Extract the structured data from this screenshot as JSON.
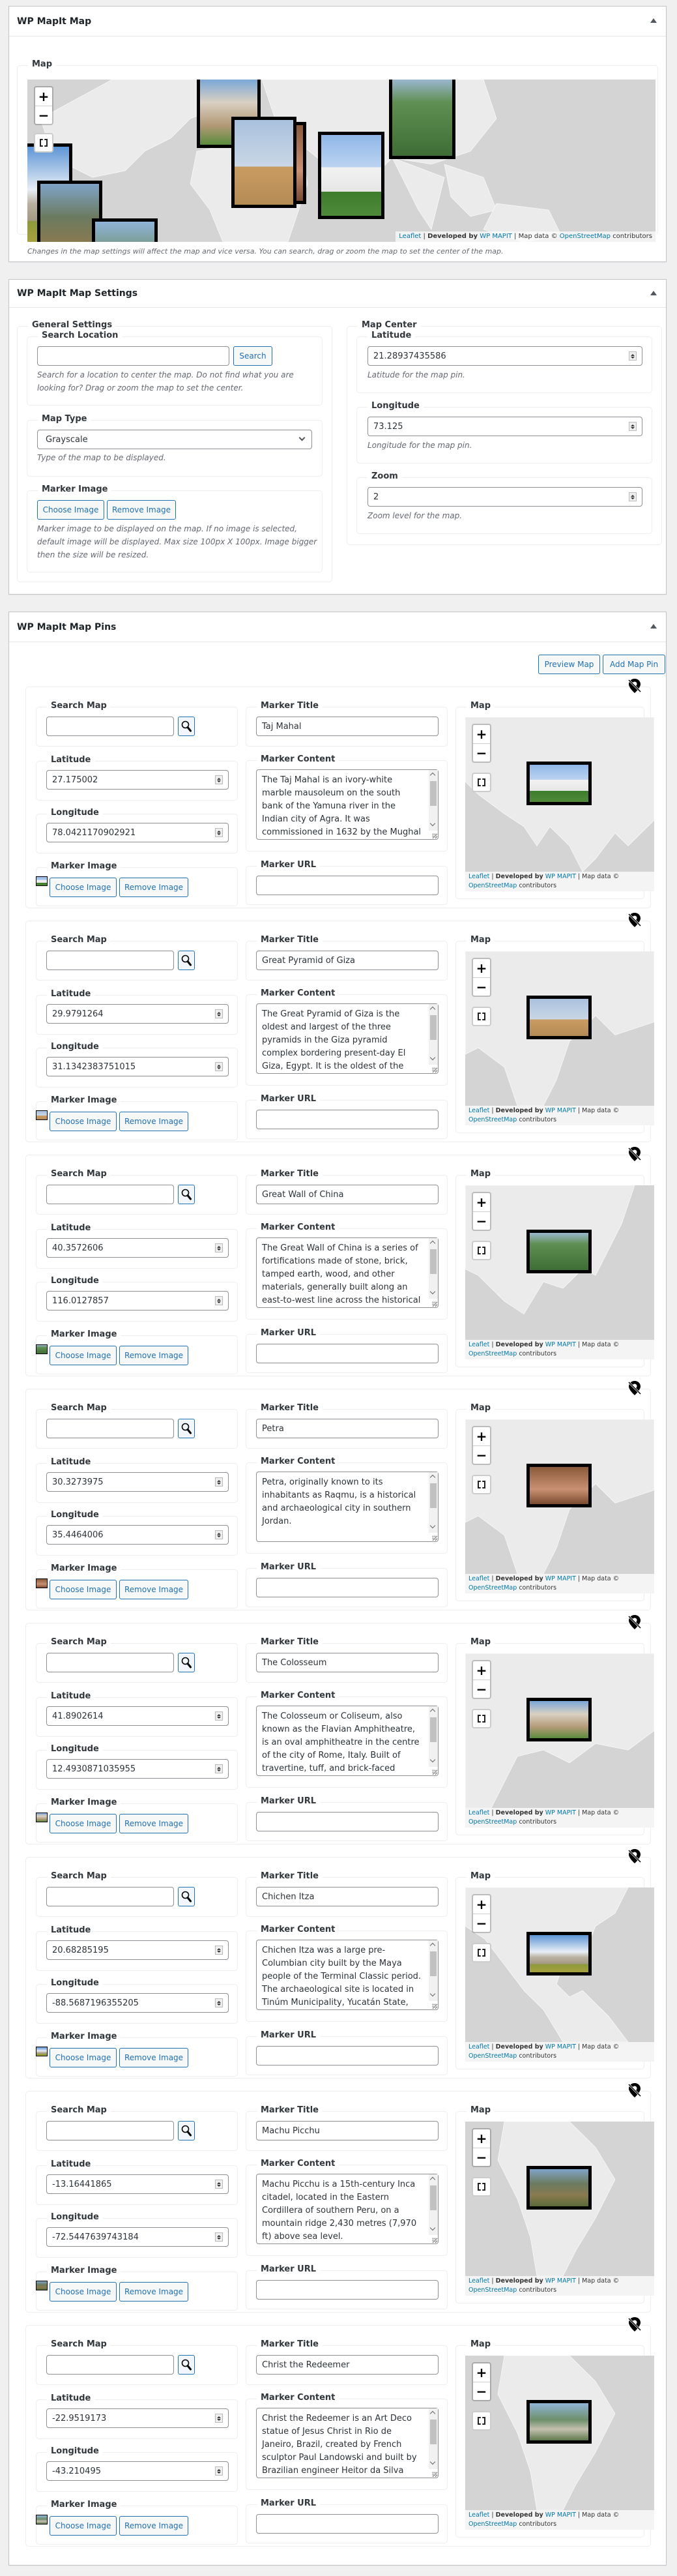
{
  "map_box": {
    "title": "WP MapIt Map",
    "map_label": "Map",
    "zoom_in": "+",
    "zoom_out": "−",
    "attribution": {
      "leaflet": "Leaflet",
      "developed_by": "Developed by",
      "wpmapit": "WP MAPIT",
      "map_data": "Map data ©",
      "osm": "OpenStreetMap",
      "contributors": "contributors"
    },
    "description": "Changes in the map settings will affect the map and vice versa. You can search, drag or zoom the map to set the center of the map.",
    "markers": [
      "The Colosseum",
      "Great Pyramid of Giza",
      "Petra",
      "Taj Mahal",
      "Great Wall of China",
      "Chichen Itza",
      "Machu Picchu",
      "Christ the Redeemer"
    ]
  },
  "settings_box": {
    "title": "WP MapIt Map Settings",
    "general": {
      "legend": "General Settings",
      "search_location": {
        "label": "Search Location",
        "value": "",
        "button": "Search",
        "description": "Search for a location to center the map. Do not find what you are looking for? Drag or zoom the map to set the center."
      },
      "map_type": {
        "label": "Map Type",
        "selected": "Grayscale",
        "description": "Type of the map to be displayed."
      },
      "marker_image": {
        "label": "Marker Image",
        "choose": "Choose Image",
        "remove": "Remove Image",
        "description": "Marker image to be displayed on the map. If no image is selected, default image will be displayed. Max size 100px X 100px. Image bigger then the size will be resized."
      }
    },
    "center": {
      "legend": "Map Center",
      "latitude": {
        "label": "Latitude",
        "value": "21.28937435586",
        "description": "Latitude for the map pin."
      },
      "longitude": {
        "label": "Longitude",
        "value": "73.125",
        "description": "Longitude for the map pin."
      },
      "zoom": {
        "label": "Zoom",
        "value": "2",
        "description": "Zoom level for the map."
      }
    }
  },
  "pins_box": {
    "title": "WP MapIt Map Pins",
    "preview_button": "Preview Map",
    "add_button": "Add Map Pin",
    "labels": {
      "search_map": "Search Map",
      "latitude": "Latitude",
      "longitude": "Longitude",
      "marker_image": "Marker Image",
      "marker_title": "Marker Title",
      "marker_content": "Marker Content",
      "marker_url": "Marker URL",
      "map": "Map",
      "choose": "Choose Image",
      "remove": "Remove Image"
    },
    "pins": [
      {
        "search": "",
        "latitude": "27.175002",
        "longitude": "78.0421170902921",
        "title": "Taj Mahal",
        "content": "The Taj Mahal is an ivory-white marble mausoleum on the south bank of the Yamuna river in the Indian city of Agra. It was commissioned in 1632 by the Mughal emperor, Shah Jahan, to house",
        "url": "",
        "image": "taj",
        "region": "asia"
      },
      {
        "search": "",
        "latitude": "29.9791264",
        "longitude": "31.1342383751015",
        "title": "Great Pyramid of Giza",
        "content": "The Great Pyramid of Giza is the oldest and largest of the three pyramids in the Giza pyramid complex bordering present-day El Giza, Egypt. It is the oldest of the Seven Wonders of the",
        "url": "",
        "image": "pyr",
        "region": "mideast"
      },
      {
        "search": "",
        "latitude": "40.3572606",
        "longitude": "116.0127857",
        "title": "Great Wall of China",
        "content": "The Great Wall of China is a series of fortifications made of stone, brick, tamped earth, wood, and other materials, generally built along an east-to-west line across the historical",
        "url": "",
        "image": "wall",
        "region": "eastasia"
      },
      {
        "search": "",
        "latitude": "30.3273975",
        "longitude": "35.4464006",
        "title": "Petra",
        "content": "Petra, originally known to its inhabitants as Raqmu, is a historical and archaeological city in southern Jordan.",
        "url": "",
        "image": "petra",
        "region": "mideast"
      },
      {
        "search": "",
        "latitude": "41.8902614",
        "longitude": "12.4930871035955",
        "title": "The Colosseum",
        "content": "The Colosseum or Coliseum, also known as the Flavian Amphitheatre, is an oval amphitheatre in the centre of the city of Rome, Italy. Built of travertine, tuff, and brick-faced",
        "url": "",
        "image": "colo",
        "region": "europe"
      },
      {
        "search": "",
        "latitude": "20.68285195",
        "longitude": "-88.5687196355205",
        "title": "Chichen Itza",
        "content": "Chichen Itza was a large pre-Columbian city built by the Maya people of the Terminal Classic period. The archaeological site is located in Tinúm Municipality, Yucatán State, Mexico.",
        "url": "",
        "image": "chich",
        "region": "americas"
      },
      {
        "search": "",
        "latitude": "-13.16441865",
        "longitude": "-72.5447639743184",
        "title": "Machu Picchu",
        "content": "Machu Picchu is a 15th-century Inca citadel, located in the Eastern Cordillera of southern Peru, on a mountain ridge 2,430 metres (7,970 ft) above sea level.",
        "url": "",
        "image": "machu",
        "region": "samerica"
      },
      {
        "search": "",
        "latitude": "-22.9519173",
        "longitude": "-43.210495",
        "title": "Christ the Redeemer",
        "content": "Christ the Redeemer is an Art Deco statue of Jesus Christ in Rio de Janeiro, Brazil, created by French sculptor Paul Landowski and built by Brazilian engineer Heitor da Silva Costa, in",
        "url": "",
        "image": "rio",
        "region": "samerica"
      }
    ]
  }
}
